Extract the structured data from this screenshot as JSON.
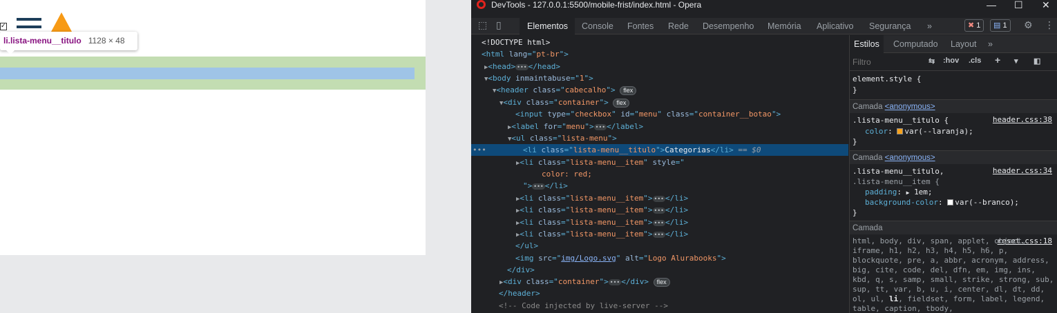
{
  "viewport": {
    "tooltip_tag": "li.lista-menu__titulo",
    "tooltip_dims": "1128 × 48"
  },
  "window": {
    "title": "DevTools - 127.0.0.1:5500/mobile-frist/index.html - Opera"
  },
  "tabs": [
    "Elementos",
    "Console",
    "Fontes",
    "Rede",
    "Desempenho",
    "Memória",
    "Aplicativo",
    "Segurança"
  ],
  "badges": {
    "errors": "1",
    "messages": "1"
  },
  "dom_lines": [
    {
      "text": "<!DOCTYPE html>"
    },
    {
      "text": "<html lang=\"pt-br\">"
    },
    {
      "text": "<head>"
    },
    {
      "text": "<body inmaintabuse=\"1\">"
    },
    {
      "text": "<header class=\"cabecalho\">"
    },
    {
      "text": "<div class=\"container\">"
    },
    {
      "text": "<input type=\"checkbox\" id=\"menu\" class=\"container__botao\">"
    },
    {
      "text": "<label for=\"menu\">"
    },
    {
      "text": "<ul class=\"lista-menu\">"
    },
    {
      "text": "<li class=\"lista-menu__titulo\">Categorias</li> == $0"
    },
    {
      "text": "<li class=\"lista-menu__item\" style=\""
    },
    {
      "text": "color: red;"
    },
    {
      "text": "\"></li>"
    },
    {
      "text": "<li class=\"lista-menu__item\"></li>"
    },
    {
      "text": "</ul>"
    },
    {
      "text": "<img src=\"img/Logo.svg\" alt=\"Logo Alurabooks\">"
    },
    {
      "text": "</div>"
    },
    {
      "text": "<div class=\"container\"></div>"
    },
    {
      "text": "</header>"
    },
    {
      "text": "<!-- Code injected by live-server -->"
    }
  ],
  "styles": {
    "tabs": [
      "Estilos",
      "Computado",
      "Layout"
    ],
    "filter_placeholder": "Filtro",
    "hov": ":hov",
    "cls": ".cls",
    "element_style": "element.style {",
    "close_brace": "}",
    "layer_label": "Camada",
    "anonymous": "<anonymous>",
    "rule1_selector": ".lista-menu__titulo {",
    "rule1_source": "header.css:38",
    "rule1_prop": "color",
    "rule1_value": "var(--laranja);",
    "rule2_selector": ".lista-menu__titulo,",
    "rule2_selector2": ".lista-menu__item {",
    "rule2_source": "header.css:34",
    "rule2_prop1": "padding",
    "rule2_val1": "1em;",
    "rule2_prop2": "background-color",
    "rule2_val2": "var(--branco);",
    "reset_source": "reset.css:18",
    "reset_selectors_before": "html, body, div, span, applet, object, iframe, h1, h2, h3, h4, h5, h6, p, blockquote, pre, a, abbr, acronym, address, big, cite, code, del, dfn, em, img, ins, kbd, q, s, samp, small, strike, strong, sub, sup, tt, var, b, u, i, center, dl, dt, dd, ol, ul,",
    "reset_highlight": "li",
    "reset_selectors_after": ", fieldset, form, label, legend, table, caption, tbody,"
  },
  "colors": {
    "laranja": "#f7a21b",
    "branco": "#ffffff",
    "highlight_padding": "#c3ddb2",
    "highlight_content": "#9fc4e7"
  }
}
